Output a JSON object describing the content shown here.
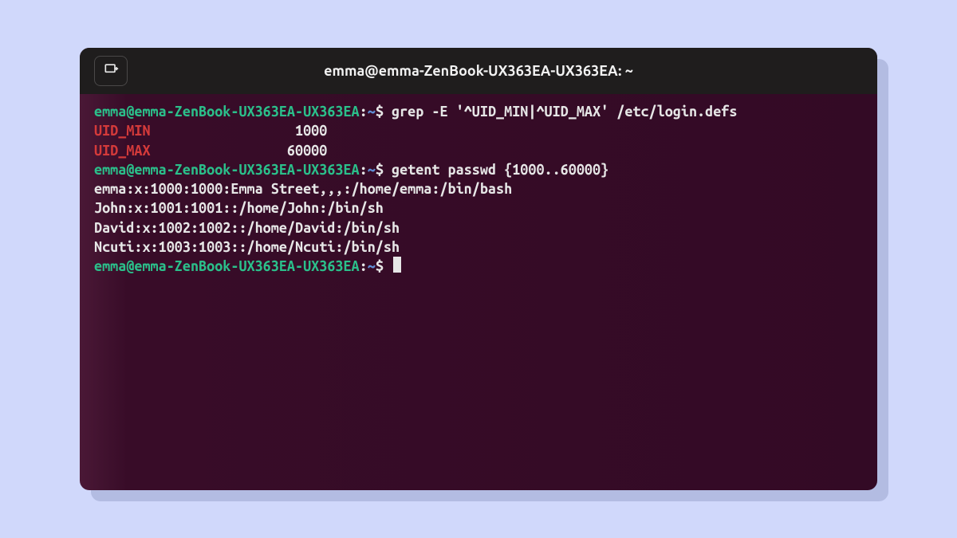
{
  "window": {
    "title": "emma@emma-ZenBook-UX363EA-UX363EA: ~"
  },
  "prompt": {
    "host": "emma@emma-ZenBook-UX363EA-UX363EA",
    "sep1": ":",
    "path": "~",
    "sep2": "$ "
  },
  "cmd1": "grep -E '^UID_MIN|^UID_MAX' /etc/login.defs",
  "grep": {
    "uid_min_label": "UID_MIN",
    "uid_min_pad": "\t\t\t ",
    "uid_min_val": "1000",
    "uid_max_label": "UID_MAX",
    "uid_max_pad": "\t\t\t",
    "uid_max_val": "60000"
  },
  "cmd2": "getent passwd {1000..60000}",
  "passwd": {
    "l0": "emma:x:1000:1000:Emma Street,,,:/home/emma:/bin/bash",
    "l1": "John:x:1001:1001::/home/John:/bin/sh",
    "l2": "David:x:1002:1002::/home/David:/bin/sh",
    "l3": "Ncuti:x:1003:1003::/home/Ncuti:/bin/sh"
  }
}
